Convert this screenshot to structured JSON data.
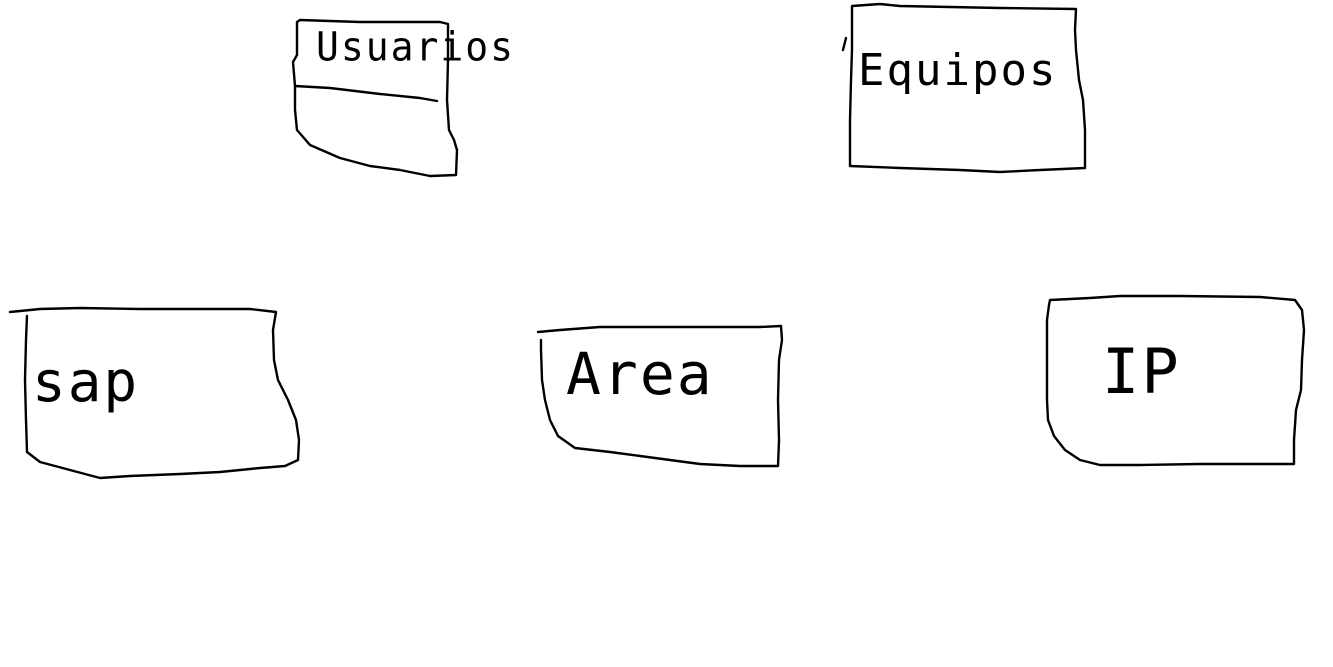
{
  "diagram": {
    "nodes": [
      {
        "id": "usuarios",
        "label": "Usuarios"
      },
      {
        "id": "equipos",
        "label": "Equipos"
      },
      {
        "id": "sap",
        "label": "sap"
      },
      {
        "id": "area",
        "label": "Area"
      },
      {
        "id": "ip",
        "label": "IP"
      }
    ]
  },
  "style": {
    "stroke_color": "#000000",
    "background": "#ffffff"
  }
}
